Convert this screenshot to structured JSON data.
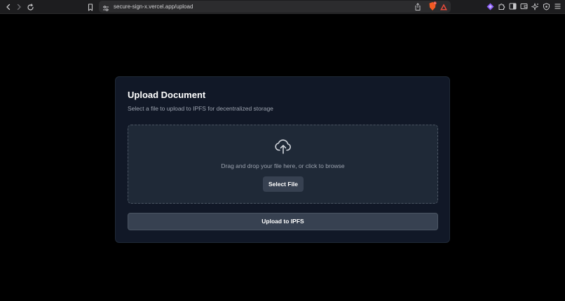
{
  "browser": {
    "url": "secure-sign-x.vercel.app/upload",
    "nav_icons": [
      "back-icon",
      "forward-icon",
      "reload-icon",
      "bookmark-icon"
    ],
    "address_icons": [
      "site-settings-icon",
      "share-icon",
      "brave-shields-icon",
      "brave-rewards-icon"
    ],
    "extension_icons": [
      "wallet-diamond-icon",
      "extensions-puzzle-icon",
      "sidebar-icon",
      "wallet-icon",
      "leo-ai-icon",
      "vpn-shield-icon",
      "menu-icon"
    ],
    "colors": {
      "toolbar_bg": "#1d1d1f",
      "address_bg": "#2c2c2e",
      "shields_orange": "#f15a22",
      "rewards_red": "#e64a3b",
      "wallet_purple": "#8b5cf6"
    }
  },
  "upload_card": {
    "title": "Upload Document",
    "subtitle": "Select a file to upload to IPFS for decentralized storage",
    "dropzone": {
      "icon": "upload-cloud-icon",
      "hint": "Drag and drop your file here, or click to browse",
      "select_button_label": "Select File"
    },
    "upload_button_label": "Upload to IPFS",
    "colors": {
      "page_bg": "#000000",
      "card_bg": "#111827",
      "dropzone_bg": "#1f2937",
      "button_bg": "#374151",
      "muted_text": "#9ca3af",
      "title_text": "#ffffff"
    }
  }
}
